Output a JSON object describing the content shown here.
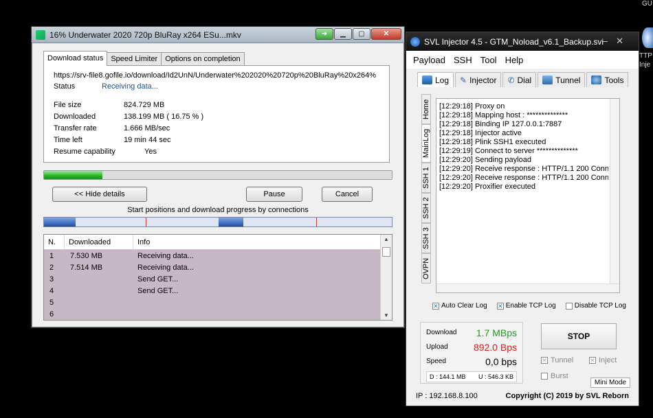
{
  "desktop": {
    "top_right_text": "GU",
    "edge_text_1": "TTP",
    "edge_text_2": "Inje"
  },
  "idm": {
    "title": "16% Underwater 2020 720p BluRay x264 ESu...mkv",
    "tabs": [
      "Download status",
      "Speed Limiter",
      "Options on completion"
    ],
    "url": "https://srv-file8.gofile.io/download/Id2UnN/Underwater%202020%20720p%20BluRay%20x264%",
    "status_label": "Status",
    "status_value": "Receiving data...",
    "file_size_label": "File size",
    "file_size_value": "824.729  MB",
    "downloaded_label": "Downloaded",
    "downloaded_value": "138.199  MB  ( 16.75 % )",
    "transfer_rate_label": "Transfer rate",
    "transfer_rate_value": "1.666  MB/sec",
    "time_left_label": "Time left",
    "time_left_value": "19 min 44 sec",
    "resume_label": "Resume capability",
    "resume_value": "Yes",
    "progress_percent": 16.75,
    "hide_details_label": "<< Hide details",
    "pause_label": "Pause",
    "cancel_label": "Cancel",
    "connections_caption": "Start positions and download progress by connections",
    "table_headers": [
      "N.",
      "Downloaded",
      "Info"
    ],
    "table_rows": [
      {
        "n": "1",
        "downloaded": "7.530  MB",
        "info": "Receiving data..."
      },
      {
        "n": "2",
        "downloaded": "7.514  MB",
        "info": "Receiving data..."
      },
      {
        "n": "3",
        "downloaded": "",
        "info": "Send GET..."
      },
      {
        "n": "4",
        "downloaded": "",
        "info": "Send GET..."
      },
      {
        "n": "5",
        "downloaded": "",
        "info": ""
      },
      {
        "n": "6",
        "downloaded": "",
        "info": ""
      }
    ]
  },
  "svl": {
    "title": "SVL Injector 4.5 - GTM_Noload_v6.1_Backup.svi",
    "menu": [
      "Payload",
      "SSH",
      "Tool",
      "Help"
    ],
    "tabs": [
      "Log",
      "Injector",
      "Dial",
      "Tunnel",
      "Tools"
    ],
    "side_tabs": [
      "Home",
      "MainLog",
      "SSH 1",
      "SSH 2",
      "SSH 3",
      "OVPN"
    ],
    "log_lines": [
      "[12:29:18] Proxy on",
      "[12:29:18] Mapping host : **************",
      "[12:29:18] Binding IP 127.0.0.1:7887",
      "[12:29:18] Injector active",
      "[12:29:18] Plink SSH1 executed",
      "[12:29:19] Connect to server **************",
      "[12:29:20] Sending payload",
      "[12:29:20] Receive response : HTTP/1.1 200 Conn",
      "[12:29:20] Receive response : HTTP/1.1 200 Conn",
      "[12:29:20] Proxifier executed"
    ],
    "auto_clear_label": "Auto Clear Log",
    "enable_tcp_label": "Enable TCP Log",
    "disable_tcp_label": "Disable TCP Log",
    "download_label": "Download",
    "download_value": "1.7 MBps",
    "upload_label": "Upload",
    "upload_value": "892.0 Bps",
    "speed_label": "Speed",
    "speed_value": "0,0 bps",
    "total_down": "D :  144.1 MB",
    "total_up": "U :  546.3 KB",
    "stop_label": "STOP",
    "tunnel_label": "Tunnel",
    "inject_label": "Inject",
    "burst_label": "Burst",
    "mini_mode_label": "Mini Mode",
    "ip_text": "IP : 192.168.8.100",
    "copyright": "Copyright (C) 2019 by SVL Reborn"
  }
}
